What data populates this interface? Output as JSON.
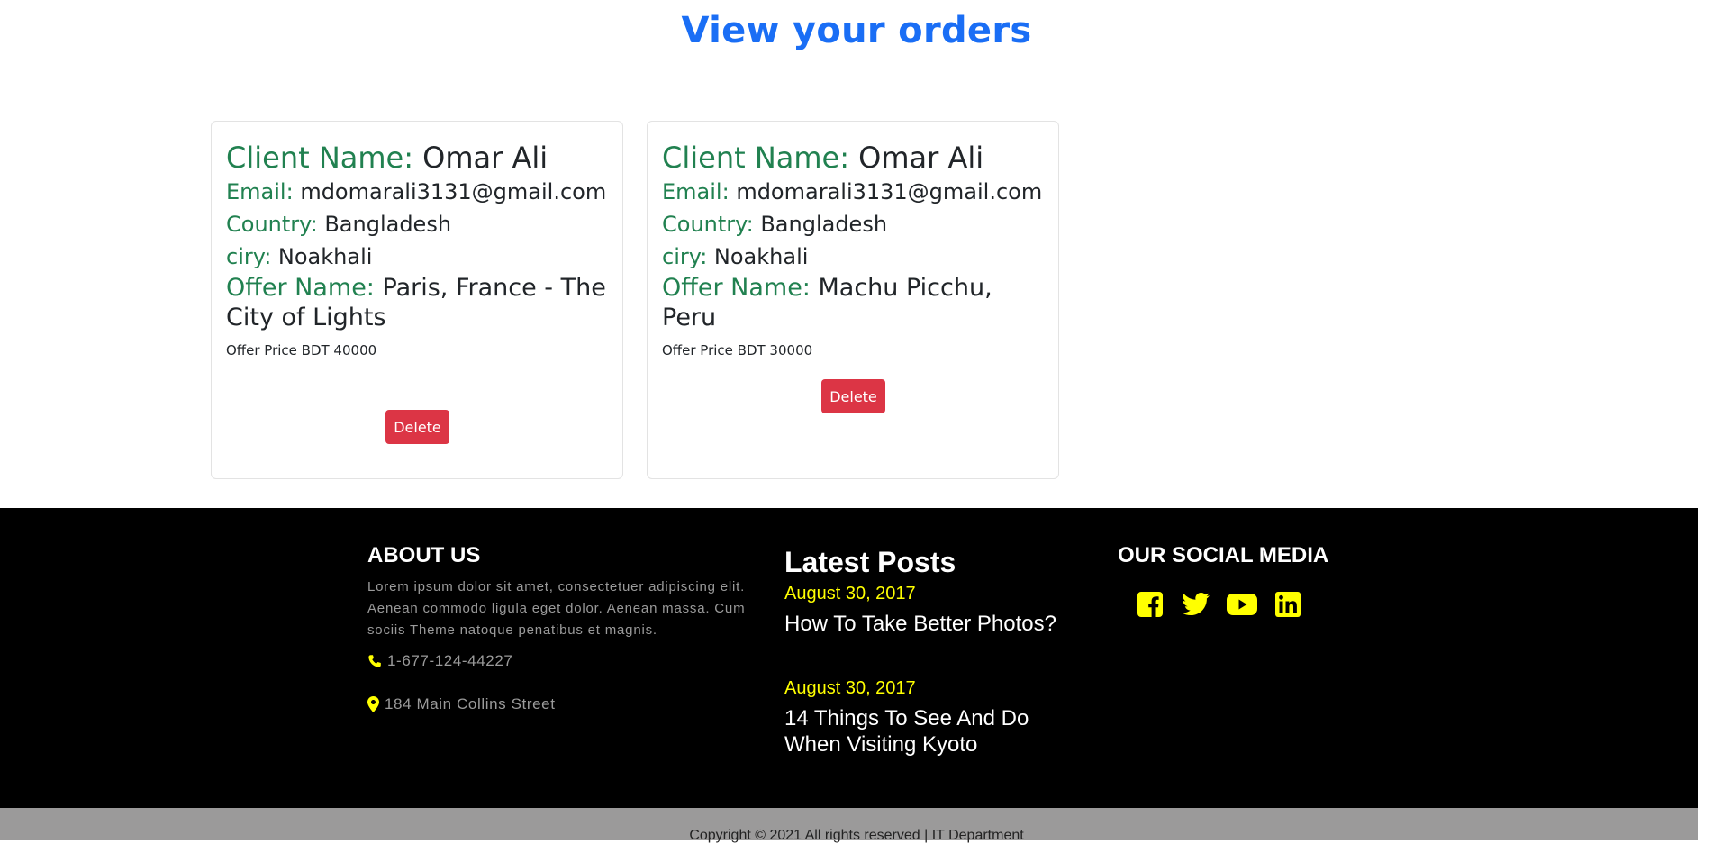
{
  "page": {
    "title": "View your orders"
  },
  "orders": [
    {
      "client_label": "Client Name:",
      "client_value": "Omar Ali",
      "email_label": "Email:",
      "email_value": "mdomarali3131@gmail.com",
      "country_label": "Country:",
      "country_value": "Bangladesh",
      "city_label": "ciry:",
      "city_value": "Noakhali",
      "offer_label": "Offer Name:",
      "offer_value": "Paris, France - The City of Lights",
      "price": "Offer Price BDT 40000",
      "delete_label": "Delete"
    },
    {
      "client_label": "Client Name:",
      "client_value": "Omar Ali",
      "email_label": "Email:",
      "email_value": "mdomarali3131@gmail.com",
      "country_label": "Country:",
      "country_value": "Bangladesh",
      "city_label": "ciry:",
      "city_value": "Noakhali",
      "offer_label": "Offer Name:",
      "offer_value": "Machu Picchu, Peru",
      "price": "Offer Price BDT 30000",
      "delete_label": "Delete"
    }
  ],
  "footer": {
    "about": {
      "heading": "ABOUT US",
      "text": "Lorem ipsum dolor sit amet, consectetuer adipiscing elit. Aenean commodo ligula eget dolor. Aenean massa. Cum sociis Theme natoque penatibus et magnis.",
      "phone": "1-677-124-44227",
      "address": "184 Main Collins Street",
      "phone_icon": "phone-icon",
      "address_icon": "map-marker-icon"
    },
    "posts": {
      "heading": "Latest Posts",
      "items": [
        {
          "date": "August 30, 2017",
          "title": "How To Take Better Photos?"
        },
        {
          "date": "August 30, 2017",
          "title": "14 Things To See And Do When Visiting Kyoto"
        }
      ]
    },
    "social": {
      "heading": "OUR SOCIAL MEDIA",
      "icons": [
        "facebook-icon",
        "twitter-icon",
        "youtube-icon",
        "linkedin-icon"
      ],
      "icon_color": "#ffff00"
    }
  },
  "copyright": "Copyright © 2021 All rights reserved | IT Department",
  "colors": {
    "title": "#1a6ef5",
    "label": "#218150",
    "delete_button": "#dc3545",
    "footer_bg": "#000000",
    "accent": "#ffff00",
    "copyright_bg": "#9b9a9a"
  }
}
